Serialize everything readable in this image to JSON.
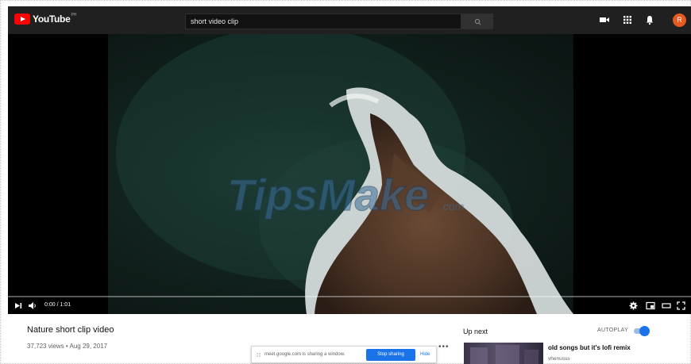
{
  "app": {
    "logo_text": "YouTube",
    "logo_superscript": "PH"
  },
  "header": {
    "search_value": "short video clip",
    "search_icon": "search-icon",
    "icons": [
      "video-camera-icon",
      "apps-grid-icon",
      "bell-icon"
    ],
    "avatar_letter": "R",
    "avatar_color": "#e65a1f"
  },
  "player": {
    "watermark": "TipsMake",
    "watermark_suffix": ".com",
    "time": "0:00 / 1:01",
    "progress_fraction": 0.0,
    "control_icons_left": [
      "next-icon",
      "volume-icon"
    ],
    "control_icons_right": [
      "settings-icon",
      "miniplayer-icon",
      "theater-icon",
      "fullscreen-icon"
    ]
  },
  "video": {
    "title": "Nature short clip video",
    "meta": "37,723 views • Aug 29, 2017",
    "more": "•••"
  },
  "sharing_bar": {
    "message": "meet.google.com is sharing a window.",
    "stop_label": "Stop sharing",
    "hide_label": "Hide"
  },
  "sidebar": {
    "up_next": "Up next",
    "autoplay_label": "AUTOPLAY",
    "autoplay_on": true,
    "recommendations": [
      {
        "title": "old songs but it's lofi remix",
        "channel": "vhenusss"
      }
    ]
  },
  "colors": {
    "header_bg": "#202020",
    "brand_red": "#ff0000",
    "accent_blue": "#1a73e8"
  }
}
